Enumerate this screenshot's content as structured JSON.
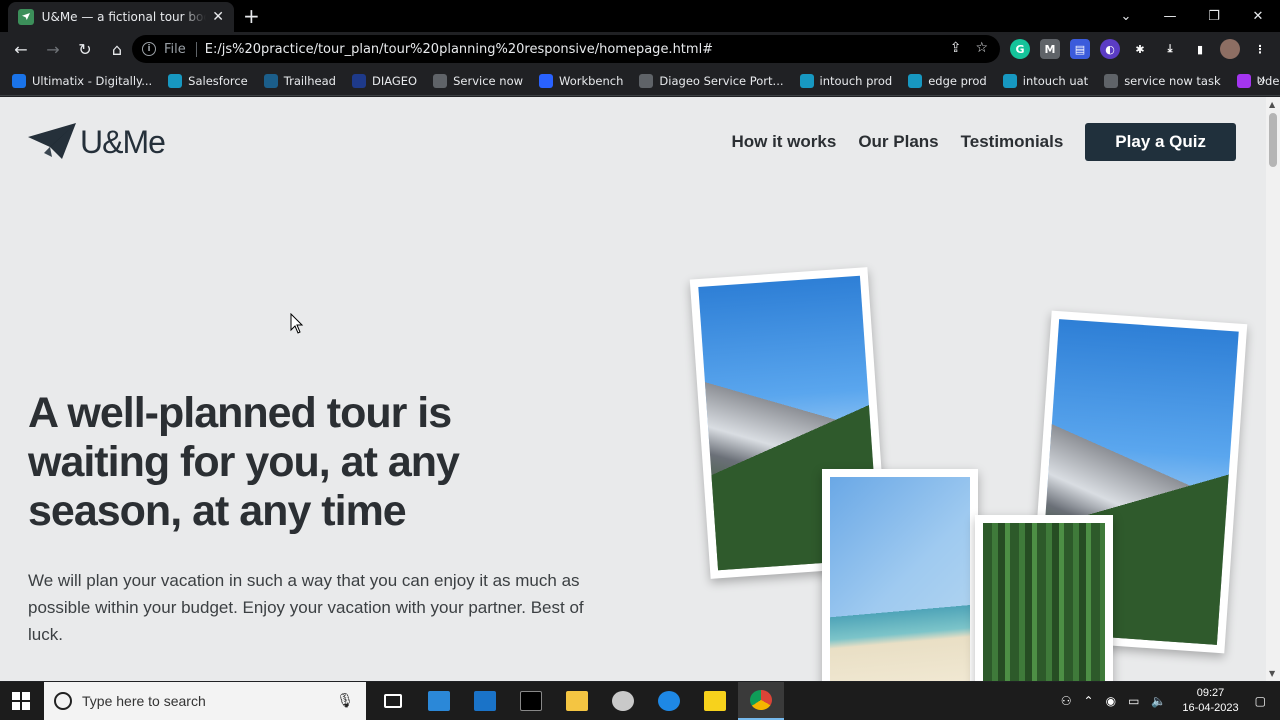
{
  "browser": {
    "tab_title": "U&Me — a fictional tour booking",
    "new_tab_symbol": "+",
    "scheme_label": "File",
    "url": "E:/js%20practice/tour_plan/tour%20planning%20responsive/homepage.html#",
    "bookmarks": [
      {
        "label": "Ultimatix - Digitally...",
        "color": "#1a73e8"
      },
      {
        "label": "Salesforce",
        "color": "#1798c1"
      },
      {
        "label": "Trailhead",
        "color": "#1b5e8a"
      },
      {
        "label": "DIAGEO",
        "color": "#1e3a8a"
      },
      {
        "label": "Service now",
        "color": "#5f6368"
      },
      {
        "label": "Workbench",
        "color": "#2962ff"
      },
      {
        "label": "Diageo Service Port...",
        "color": "#5f6368"
      },
      {
        "label": "intouch prod",
        "color": "#1798c1"
      },
      {
        "label": "edge prod",
        "color": "#1798c1"
      },
      {
        "label": "intouch uat",
        "color": "#1798c1"
      },
      {
        "label": "service now task",
        "color": "#5f6368"
      },
      {
        "label": "Udemy",
        "color": "#a435f0"
      }
    ]
  },
  "site": {
    "logo_text": "U&Me",
    "nav": [
      "How it works",
      "Our Plans",
      "Testimonials"
    ],
    "cta_label": "Play a Quiz",
    "headline": "A well-planned tour is waiting for you, at any season, at any time",
    "description": "We will plan your vacation in such a way that you can enjoy it as much as possible within your budget. Enjoy your vacation with your partner. Best of luck."
  },
  "taskbar": {
    "search_placeholder": "Type here to search",
    "time": "09:27",
    "date": "16-04-2023"
  },
  "colors": {
    "page_bg": "#e9eaeb",
    "cta_bg": "#20303c",
    "heading_text": "#2b2f33"
  }
}
